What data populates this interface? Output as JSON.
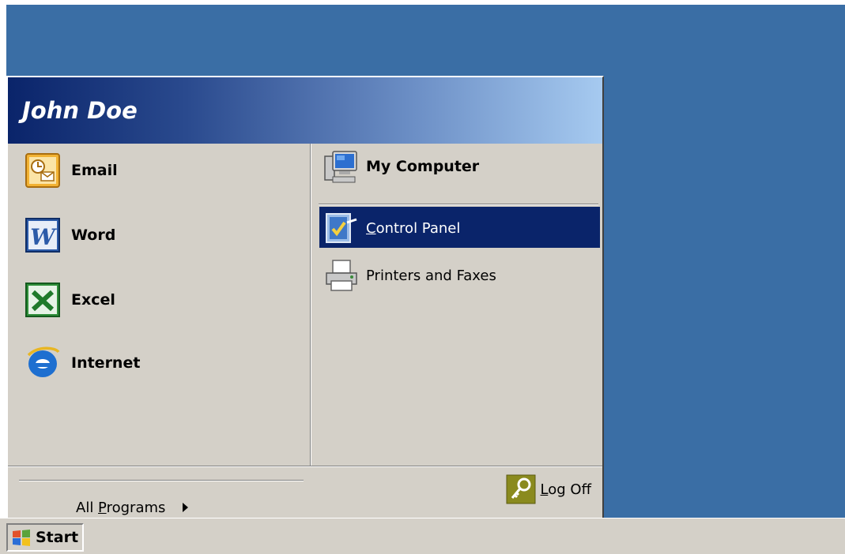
{
  "colors": {
    "desktop": "#3a6ea5",
    "menu": "#d4d0c8",
    "header_dark": "#0a246a",
    "header_light": "#a6caf0",
    "highlight": "#0a246a"
  },
  "start_menu": {
    "user_name": "John Doe",
    "pinned": [
      {
        "label": "Email",
        "icon": "email-icon"
      },
      {
        "label": "Word",
        "icon": "word-icon"
      },
      {
        "label": "Excel",
        "icon": "excel-icon"
      },
      {
        "label": "Internet",
        "icon": "internet-explorer-icon"
      }
    ],
    "all_programs": {
      "prefix": "All ",
      "accel": "P",
      "suffix": "rograms"
    },
    "places": {
      "my_computer": {
        "label": "My Computer",
        "icon": "my-computer-icon"
      },
      "control_panel": {
        "accel": "C",
        "suffix": "ontrol Panel",
        "icon": "control-panel-icon",
        "highlighted": true
      },
      "printers": {
        "label": "Printers and Faxes",
        "icon": "printer-icon"
      }
    },
    "log_off": {
      "accel": "L",
      "suffix": "og Off",
      "icon": "key-icon"
    }
  },
  "taskbar": {
    "start_label": "Start",
    "start_icon": "windows-flag-icon"
  }
}
